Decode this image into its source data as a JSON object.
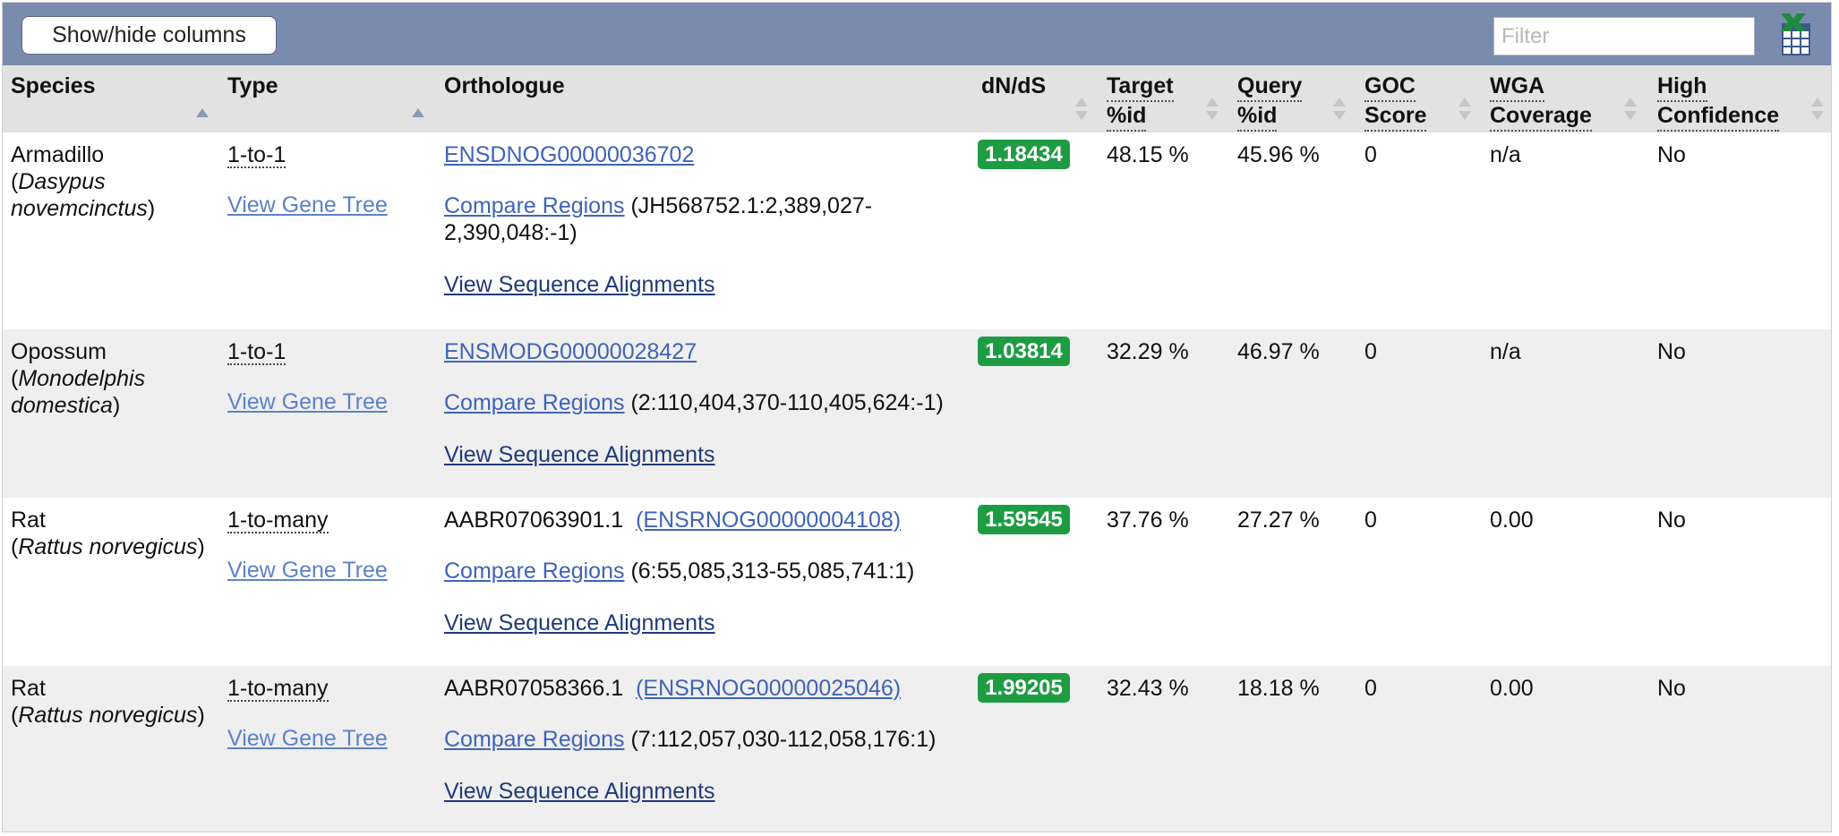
{
  "toolbar": {
    "show_hide_label": "Show/hide columns",
    "filter_placeholder": "Filter",
    "export_icon": "excel-export-icon"
  },
  "columns": [
    {
      "key": "species",
      "label": "Species",
      "sort": "asc"
    },
    {
      "key": "type",
      "label": "Type",
      "sort": "asc"
    },
    {
      "key": "orthologue",
      "label": "Orthologue",
      "sort": "none"
    },
    {
      "key": "dnds",
      "label": "dN/dS",
      "sort": "both"
    },
    {
      "key": "target_id",
      "label1": "Target",
      "label2": "%id",
      "sort": "both"
    },
    {
      "key": "query_id",
      "label1": "Query",
      "label2": "%id",
      "sort": "both"
    },
    {
      "key": "goc",
      "label1": "GOC",
      "label2": "Score",
      "sort": "both"
    },
    {
      "key": "wga",
      "label1": "WGA",
      "label2": "Coverage",
      "sort": "both"
    },
    {
      "key": "high_conf",
      "label1": "High",
      "label2": "Confidence",
      "sort": "both"
    }
  ],
  "rows": [
    {
      "species_common": "Armadillo",
      "species_sci_line1": "Dasypus",
      "species_sci_line2": "novemcinctus",
      "type": "1-to-1",
      "gene_tree": "View Gene Tree",
      "orth_prefix": "",
      "orth_id": "ENSDNOG00000036702",
      "compare": "Compare Regions",
      "compare_coord_a": "(JH568752.1:2,389,027-",
      "compare_coord_b": "2,390,048:-1)",
      "alignments": "View Sequence Alignments",
      "dnds": "1.18434",
      "target_id": "48.15 %",
      "query_id": "45.96 %",
      "goc": "0",
      "wga": "n/a",
      "high_conf": "No"
    },
    {
      "species_common": "Opossum",
      "species_sci_line1": "Monodelphis",
      "species_sci_line2": "domestica",
      "type": "1-to-1",
      "gene_tree": "View Gene Tree",
      "orth_prefix": "",
      "orth_id": "ENSMODG00000028427",
      "compare": "Compare Regions",
      "compare_coord_a": "(2:110,404,370-110,405,624:-1)",
      "compare_coord_b": "",
      "alignments": "View Sequence Alignments",
      "dnds": "1.03814",
      "target_id": "32.29 %",
      "query_id": "46.97 %",
      "goc": "0",
      "wga": "n/a",
      "high_conf": "No"
    },
    {
      "species_common": "Rat",
      "species_sci_line1": "Rattus norvegicus",
      "species_sci_line2": "",
      "type": "1-to-many",
      "gene_tree": "View Gene Tree",
      "orth_prefix": "AABR07063901.1",
      "orth_id": "(ENSRNOG00000004108)",
      "compare": "Compare Regions",
      "compare_coord_a": "(6:55,085,313-55,085,741:1)",
      "compare_coord_b": "",
      "alignments": "View Sequence Alignments",
      "dnds": "1.59545",
      "target_id": "37.76 %",
      "query_id": "27.27 %",
      "goc": "0",
      "wga": "0.00",
      "high_conf": "No"
    },
    {
      "species_common": "Rat",
      "species_sci_line1": "Rattus norvegicus",
      "species_sci_line2": "",
      "type": "1-to-many",
      "gene_tree": "View Gene Tree",
      "orth_prefix": "AABR07058366.1",
      "orth_id": "(ENSRNOG00000025046)",
      "compare": "Compare Regions",
      "compare_coord_a": "(7:112,057,030-112,058,176:1)",
      "compare_coord_b": "",
      "alignments": "View Sequence Alignments",
      "dnds": "1.99205",
      "target_id": "32.43 %",
      "query_id": "18.18 %",
      "goc": "0",
      "wga": "0.00",
      "high_conf": "No"
    }
  ],
  "colors": {
    "toolbar_bg": "#7b8bad",
    "header_bg": "#e2e2e2",
    "link": "#3f63b8",
    "badge_bg": "#1e9c43",
    "stripe": "#efefef"
  }
}
